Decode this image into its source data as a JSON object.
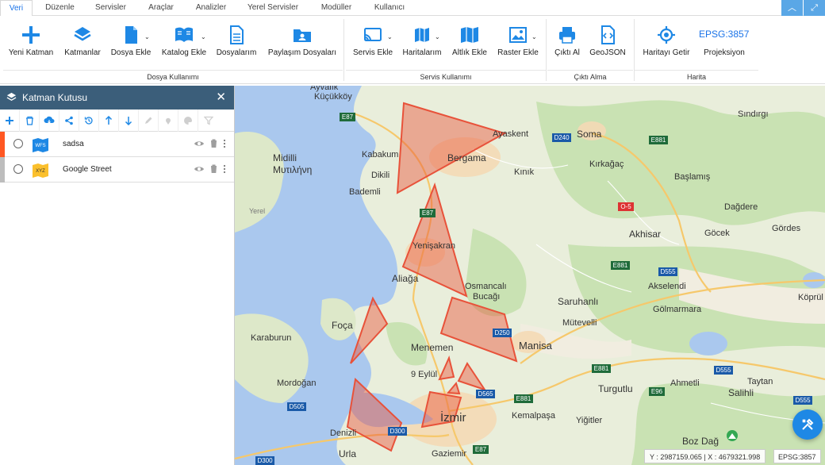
{
  "menu": {
    "items": [
      "Veri",
      "Düzenle",
      "Servisler",
      "Araçlar",
      "Analizler",
      "Yerel Servisler",
      "Modüller",
      "Kullanıcı"
    ]
  },
  "ribbon": {
    "tools": {
      "new_layer": "Yeni Katman",
      "layers": "Katmanlar",
      "add_file": "Dosya Ekle",
      "add_catalog": "Katalog Ekle",
      "my_files": "Dosyalarım",
      "shared_files": "Paylaşım Dosyaları",
      "add_service": "Servis Ekle",
      "my_maps": "Haritalarım",
      "add_basemap": "Altlık Ekle",
      "add_raster": "Raster Ekle",
      "export": "Çıktı Al",
      "geojson": "GeoJSON",
      "get_map": "Haritayı Getir",
      "projection": "Projeksiyon",
      "epsg": "EPSG:3857"
    },
    "groups": {
      "file_use": "Dosya Kullanımı",
      "service_use": "Servis Kullanımı",
      "output": "Çıktı Alma",
      "map": "Harita"
    }
  },
  "panel": {
    "title": "Katman Kutusu",
    "layers": [
      {
        "name": "sadsa",
        "badge": "WFS",
        "stripe": "#ff5722"
      },
      {
        "name": "Google Street",
        "badge": "XYZ",
        "stripe": "#bdbdbd"
      }
    ]
  },
  "map": {
    "places": {
      "ayvalik": "Ayvalık",
      "kucukkoy": "Küçükköy",
      "midilli": "Midilli",
      "mytilene": "Μυτιλήνη",
      "kabakum": "Kabakum",
      "dikili": "Dikili",
      "bademli": "Bademli",
      "bergama": "Bergama",
      "ayaskent": "Ayaskent",
      "kinik": "Kınık",
      "soma": "Soma",
      "kirkagac": "Kırkağaç",
      "sindirgi": "Sındırgı",
      "baslamis": "Başlamış",
      "dagdere": "Dağdere",
      "gocek": "Göcek",
      "gordes": "Gördes",
      "akhisar": "Akhisar",
      "yenisakran": "Yenişakran",
      "aliaga": "Aliağa",
      "osmancali": "Osmancalı",
      "bucagi": "Bucağı",
      "saruhanli": "Saruhanlı",
      "akselendi": "Akselendi",
      "golmarmara": "Gölmarmara",
      "koprulu": "Köprül",
      "foca": "Foça",
      "karaburun": "Karaburun",
      "menemen": "Menemen",
      "manisa": "Manisa",
      "mutevelli": "Mütevelli",
      "eylul": "9 Eylül",
      "mordogan": "Mordoğan",
      "turgutlu": "Turgutlu",
      "ahmetli": "Ahmetli",
      "taytan": "Taytan",
      "salihli": "Salihli",
      "izmir": "İzmir",
      "kemalpasa": "Kemalpaşa",
      "yigitler": "Yiğitler",
      "bozdag": "Boz Dağ",
      "denizli": "Denizli",
      "urla": "Urla",
      "gaziemir": "Gaziemir",
      "yeniyer": "Yerel"
    },
    "roads": {
      "e87a": "E87",
      "e87b": "E87",
      "e87c": "E87",
      "d240": "D240",
      "e881a": "E881",
      "e881b": "E881",
      "e881c": "E881",
      "e881d": "E881",
      "o5": "O-5",
      "d555a": "D555",
      "d555b": "D555",
      "d555c": "D555",
      "d250": "D250",
      "d565": "D565",
      "e96": "E96",
      "d505": "D505",
      "d300a": "D300",
      "d300b": "D300"
    },
    "coords": "Y : 2987159.065 | X : 4679321.998",
    "epsg": "EPSG:3857",
    "polygon_fill": "#e8523a",
    "water": "#aac8ee",
    "land": "#e9eedb"
  }
}
